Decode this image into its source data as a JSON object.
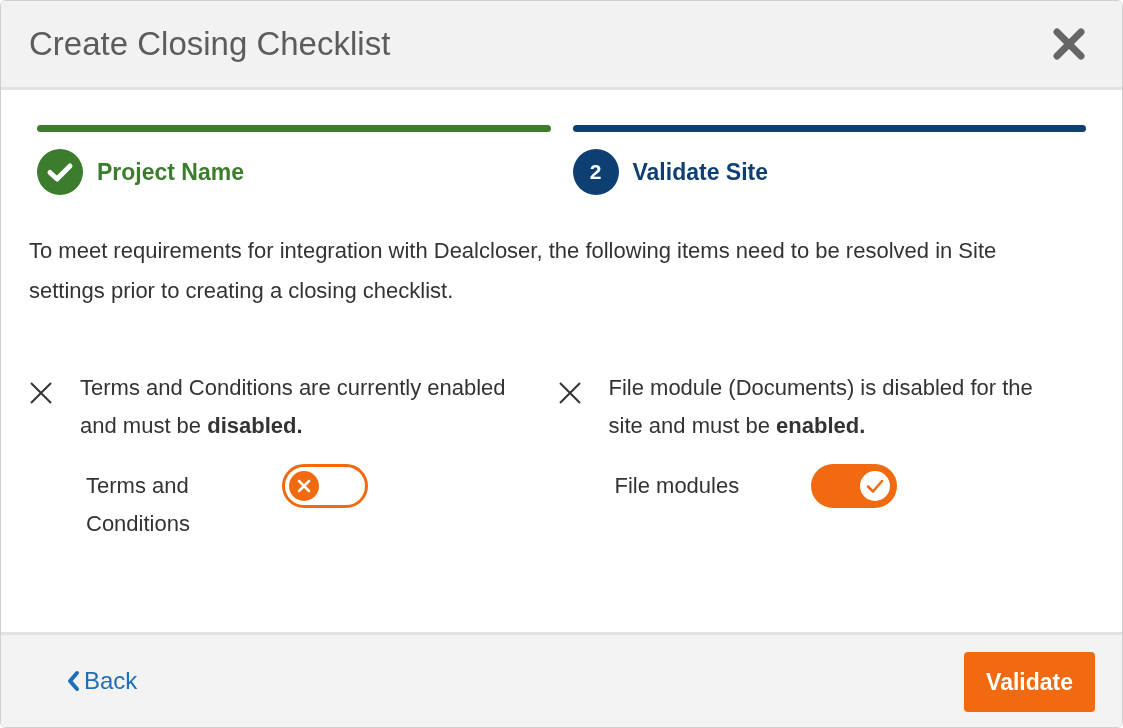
{
  "dialog": {
    "title": "Create Closing Checklist"
  },
  "steps": [
    {
      "label": "Project Name",
      "done": true
    },
    {
      "label": "Validate Site",
      "done": false,
      "number": "2"
    }
  ],
  "intro": "To meet requirements for integration with Dealcloser, the following items need to be resolved in Site settings prior to creating a closing checklist.",
  "requirements": [
    {
      "message": "Terms and Conditions are currently enabled and must be **disabled.**",
      "toggle_label": "Terms and Conditions",
      "on": false
    },
    {
      "message": "File module (Documents) is disabled for the site and must be **enabled.**",
      "toggle_label": "File modules",
      "on": true
    }
  ],
  "footer": {
    "back": "Back",
    "validate": "Validate"
  }
}
